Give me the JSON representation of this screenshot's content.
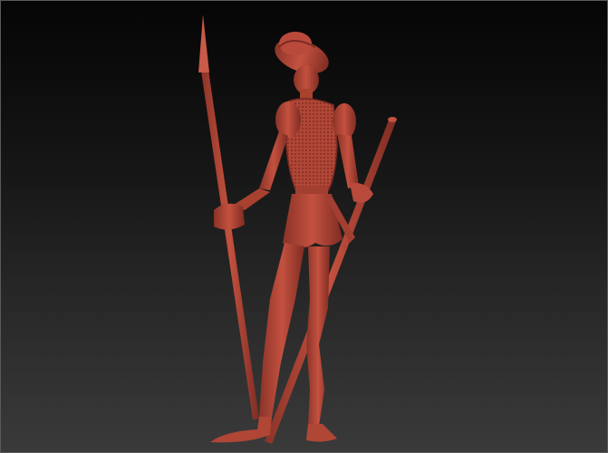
{
  "viewport": {
    "background_top": "#050505",
    "background_bottom": "#3a3a3a",
    "frame_color": "#5a5a5a"
  },
  "model": {
    "material_color": "#b94a3b",
    "material_shadow": "#7a2a22",
    "material_highlight": "#d96a58",
    "subject": "knight-with-lance-sculpt"
  }
}
